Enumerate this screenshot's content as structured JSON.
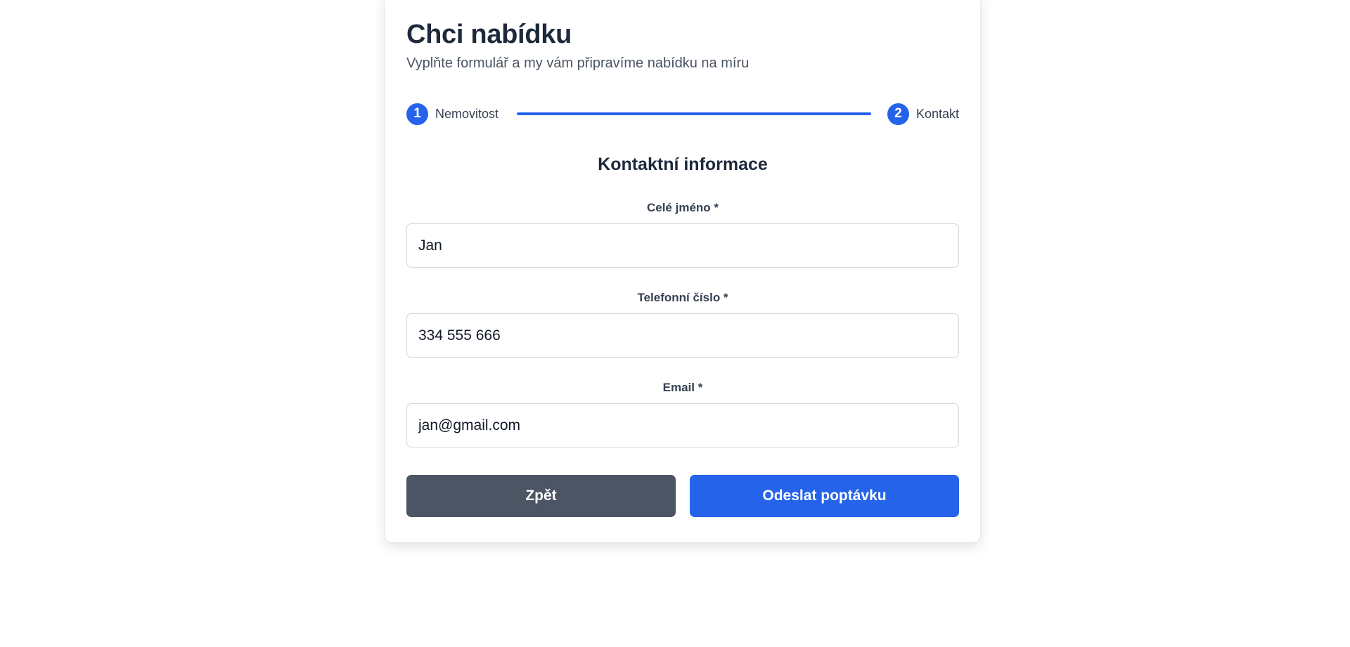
{
  "header": {
    "title": "Chci nabídku",
    "subtitle": "Vyplňte formulář a my vám připravíme nabídku na míru"
  },
  "stepper": {
    "steps": [
      {
        "number": "1",
        "label": "Nemovitost",
        "state": "completed"
      },
      {
        "number": "2",
        "label": "Kontakt",
        "state": "active"
      }
    ]
  },
  "form": {
    "section_title": "Kontaktní informace",
    "fields": [
      {
        "label": "Celé jméno *",
        "value": "Jan"
      },
      {
        "label": "Telefonní číslo *",
        "value": "334 555 666"
      },
      {
        "label": "Email *",
        "value": "jan@gmail.com"
      }
    ]
  },
  "actions": {
    "back_label": "Zpět",
    "submit_label": "Odeslat poptávku"
  },
  "colors": {
    "primary": "#2563eb",
    "secondary_button": "#4b5563",
    "heading": "#1e293b",
    "muted_text": "#4b5563",
    "input_border": "#d1d5db"
  }
}
